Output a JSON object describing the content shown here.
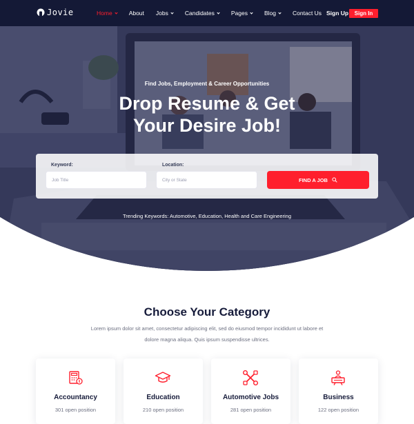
{
  "brand": {
    "name": "Jovie"
  },
  "nav": {
    "items": [
      {
        "label": "Home",
        "dropdown": true,
        "active": true
      },
      {
        "label": "About",
        "dropdown": false,
        "active": false
      },
      {
        "label": "Jobs",
        "dropdown": true,
        "active": false
      },
      {
        "label": "Candidates",
        "dropdown": true,
        "active": false
      },
      {
        "label": "Pages",
        "dropdown": true,
        "active": false
      },
      {
        "label": "Blog",
        "dropdown": true,
        "active": false
      },
      {
        "label": "Contact Us",
        "dropdown": false,
        "active": false
      }
    ],
    "sign_up": "Sign Up",
    "sign_in": "Sign In"
  },
  "hero": {
    "eyebrow": "Find Jobs, Employment & Career Opportunities",
    "title_line1": "Drop Resume & Get",
    "title_line2": "Your Desire Job!",
    "search": {
      "keyword_label": "Keyword:",
      "keyword_placeholder": "Job Title",
      "location_label": "Location:",
      "location_placeholder": "City or State",
      "button_label": "FIND A JOB"
    },
    "trending": "Trending Keywords: Automotive, Education, Health and Care Engineering"
  },
  "category": {
    "title": "Choose Your Category",
    "description": "Lorem ipsum dolor sit amet, consectetur adipiscing elit, sed do eiusmod tempor incididunt ut labore et dolore magna aliqua. Quis ipsum suspendisse ultrices.",
    "cards": [
      {
        "title": "Accountancy",
        "sub": "301 open position",
        "icon": "accounting-icon"
      },
      {
        "title": "Education",
        "sub": "210 open position",
        "icon": "graduation-cap-icon"
      },
      {
        "title": "Automotive Jobs",
        "sub": "281 open position",
        "icon": "tools-icon"
      },
      {
        "title": "Business",
        "sub": "122 open position",
        "icon": "presentation-icon"
      }
    ]
  },
  "colors": {
    "accent": "#ff1f2d",
    "nav_bg": "#141936",
    "heading": "#161b3a",
    "hero_overlay": "#2c3152"
  }
}
